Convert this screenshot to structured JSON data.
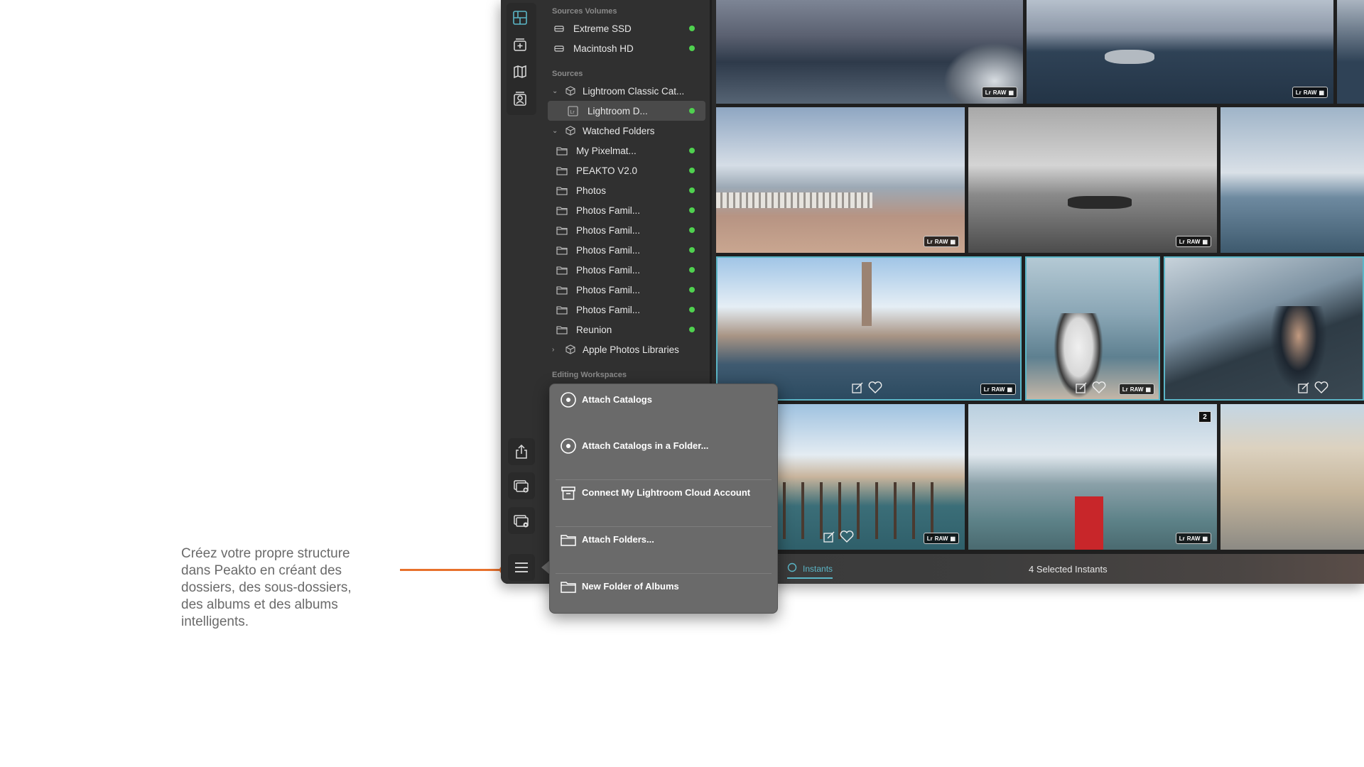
{
  "caption": {
    "text": "Créez votre propre structure dans Peakto en créant des dossiers, des sous-dossiers, des albums et des albums intelligents."
  },
  "colors": {
    "accent": "#5bb6c7",
    "arrow": "#e8712c",
    "online_dot": "#4fd14f"
  },
  "rail": {
    "top_icons": [
      "layout-grid-icon",
      "add-card-icon",
      "map-icon",
      "people-icon"
    ],
    "bottom_icons": [
      "share-icon",
      "add-photos-icon",
      "import-photos-icon",
      "menu-icon"
    ]
  },
  "sidebar": {
    "volumes_header": "Sources Volumes",
    "volumes": [
      {
        "label": "Extreme SSD"
      },
      {
        "label": "Macintosh HD"
      }
    ],
    "sources_header": "Sources",
    "lightroom_group": "Lightroom Classic Cat...",
    "lightroom_item": "Lightroom D...",
    "watched_group": "Watched Folders",
    "watched_items": [
      {
        "label": "My Pixelmat..."
      },
      {
        "label": "PEAKTO V2.0"
      },
      {
        "label": "Photos"
      },
      {
        "label": "Photos Famil..."
      },
      {
        "label": "Photos Famil..."
      },
      {
        "label": "Photos Famil..."
      },
      {
        "label": "Photos Famil..."
      },
      {
        "label": "Photos Famil..."
      },
      {
        "label": "Photos Famil..."
      },
      {
        "label": "Reunion"
      }
    ],
    "apple_group": "Apple Photos Libraries",
    "editing_header": "Editing Workspaces"
  },
  "photo_badge": {
    "raw": "RAW"
  },
  "grid": {
    "stack_count": "2"
  },
  "statusbar": {
    "tab_label": "Instants",
    "selected": "4 Selected Instants"
  },
  "menu": {
    "items": [
      {
        "label": "Attach Catalogs",
        "icon": "catalog-icon"
      },
      {
        "label": "Attach Catalogs in a Folder...",
        "icon": "catalog-icon"
      },
      {
        "label": "Connect My Lightroom Cloud Account",
        "icon": "archive-icon"
      },
      {
        "label": "Attach Folders...",
        "icon": "folder-icon"
      },
      {
        "label": "New Folder of Albums",
        "icon": "folder-icon"
      }
    ]
  }
}
